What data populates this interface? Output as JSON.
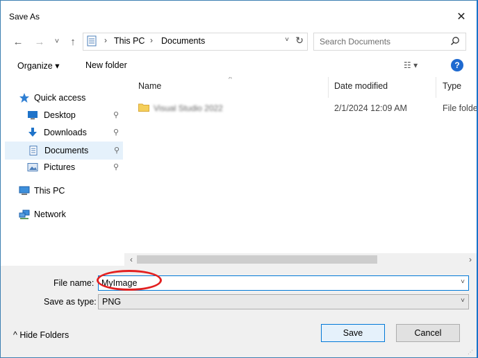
{
  "window": {
    "title": "Save As",
    "close_glyph": "✕"
  },
  "nav": {
    "back_glyph": "←",
    "forward_glyph": "→",
    "recent_glyph": "˅",
    "up_glyph": "↑",
    "breadcrumb": [
      "This PC",
      "Documents"
    ],
    "breadcrumb_sep": "›",
    "dropdown_glyph": "˅",
    "refresh_glyph": "↻"
  },
  "search": {
    "placeholder": "Search Documents"
  },
  "toolbar": {
    "organize": "Organize ▾",
    "new_folder": "New folder",
    "view_glyph": "☷ ▾",
    "help_glyph": "?"
  },
  "sidebar": {
    "items": [
      {
        "label": "Quick access",
        "icon": "star-icon"
      },
      {
        "label": "Desktop",
        "icon": "desktop-icon",
        "pinned": true
      },
      {
        "label": "Downloads",
        "icon": "download-icon",
        "pinned": true
      },
      {
        "label": "Documents",
        "icon": "documents-icon",
        "pinned": true,
        "selected": true
      },
      {
        "label": "Pictures",
        "icon": "pictures-icon",
        "pinned": true
      },
      {
        "label": "This PC",
        "icon": "computer-icon"
      },
      {
        "label": "Network",
        "icon": "network-icon"
      }
    ],
    "pin_glyph": "📌"
  },
  "columns": {
    "name": "Name",
    "date": "Date modified",
    "type": "Type",
    "sort_glyph": "^"
  },
  "files": [
    {
      "name": "Visual Studio 2022",
      "date": "2/1/2024 12:09 AM",
      "type": "File folder"
    }
  ],
  "scrollbar": {
    "left_glyph": "‹",
    "right_glyph": "›"
  },
  "form": {
    "filename_label": "File name:",
    "filename_value": "MyImage",
    "savetype_label": "Save as type:",
    "savetype_value": "PNG",
    "dd_glyph": "˅"
  },
  "footer": {
    "hide_folders": "^  Hide Folders",
    "save": "Save",
    "cancel": "Cancel"
  },
  "colors": {
    "accent": "#0078d7",
    "selection": "#e5f1fb",
    "annotation": "#e32020"
  }
}
